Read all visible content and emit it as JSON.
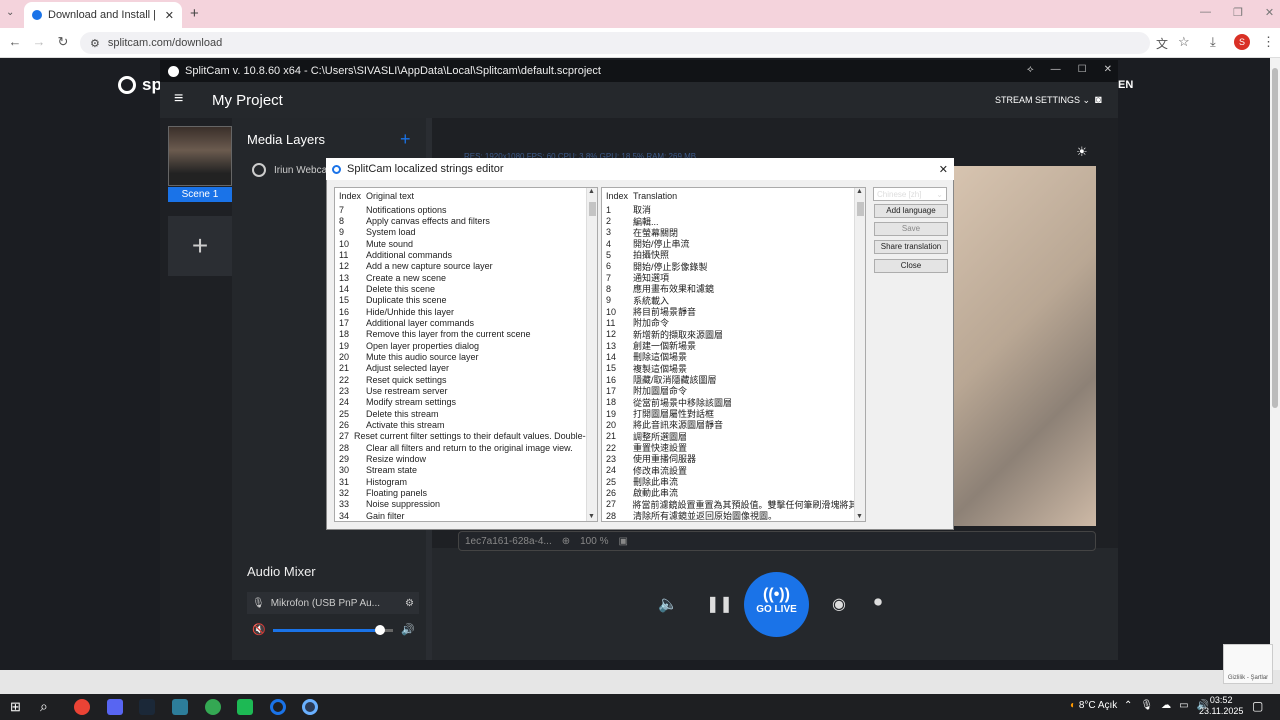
{
  "browser": {
    "tab_title": "Download and Install | SplitCam",
    "url": "splitcam.com/download",
    "profile_initial": "S"
  },
  "site": {
    "logo_text": "spl",
    "lang": "EN"
  },
  "splitcam": {
    "window_title": "SplitCam v. 10.8.60 x64 - C:\\Users\\SIVASLI\\AppData\\Local\\Splitcam\\default.scproject",
    "project_name": "My Project",
    "stream_settings": "STREAM SETTINGS",
    "scene_label": "Scene 1",
    "media_layers_title": "Media Layers",
    "layer_name": "Iriun Webca",
    "stats": "RES: 1920x1080   FPS: 60   CPU: 3.8%   GPU: 18.5%   RAM: 269 MB",
    "info_id": "1ec7a161-628a-4...",
    "zoom": "100 %",
    "go_live": "GO LIVE",
    "audio_mixer_title": "Audio Mixer",
    "mic_name": "Mikrofon (USB PnP Au...",
    "volume": 0.85
  },
  "dialog": {
    "title": "SplitCam localized strings editor",
    "left_headers": [
      "Index",
      "Original text"
    ],
    "right_headers": [
      "Index",
      "Translation"
    ],
    "original": [
      [
        "7",
        "Notifications options"
      ],
      [
        "8",
        "Apply canvas effects and filters"
      ],
      [
        "9",
        "System load"
      ],
      [
        "10",
        "Mute sound"
      ],
      [
        "11",
        "Additional commands"
      ],
      [
        "12",
        "Add a new capture source layer"
      ],
      [
        "13",
        "Create a new scene"
      ],
      [
        "14",
        "Delete this scene"
      ],
      [
        "15",
        "Duplicate this scene"
      ],
      [
        "16",
        "Hide/Unhide this layer"
      ],
      [
        "17",
        "Additional layer commands"
      ],
      [
        "18",
        "Remove this layer from the current scene"
      ],
      [
        "19",
        "Open layer properties dialog"
      ],
      [
        "20",
        "Mute this audio source layer"
      ],
      [
        "21",
        "Adjust selected layer"
      ],
      [
        "22",
        "Reset quick settings"
      ],
      [
        "23",
        "Use restream server"
      ],
      [
        "24",
        "Modify stream settings"
      ],
      [
        "25",
        "Delete this stream"
      ],
      [
        "26",
        "Activate this stream"
      ],
      [
        "27",
        "Reset current filter settings to their default values. Double-click a..."
      ],
      [
        "28",
        "Clear all filters and return to the original image view."
      ],
      [
        "29",
        "Resize window"
      ],
      [
        "30",
        "Stream state"
      ],
      [
        "31",
        "Histogram"
      ],
      [
        "32",
        "Floating panels"
      ],
      [
        "33",
        "Noise suppression"
      ],
      [
        "34",
        "Gain filter"
      ]
    ],
    "translation": [
      [
        "1",
        "取消"
      ],
      [
        "2",
        "編輯..."
      ],
      [
        "3",
        "在螢幕關閉"
      ],
      [
        "4",
        "開始/停止串流"
      ],
      [
        "5",
        "拍攝快照"
      ],
      [
        "6",
        "開始/停止影像錄製"
      ],
      [
        "7",
        "通知選項"
      ],
      [
        "8",
        "應用畫布效果和濾鏡"
      ],
      [
        "9",
        "系統載入"
      ],
      [
        "10",
        "將目前場景靜音"
      ],
      [
        "11",
        "附加命令"
      ],
      [
        "12",
        "新增新的擷取來源圖層"
      ],
      [
        "13",
        "創建一個新場景"
      ],
      [
        "14",
        "刪除這個場景"
      ],
      [
        "15",
        "複製這個場景"
      ],
      [
        "16",
        "隱藏/取消隱藏該圖層"
      ],
      [
        "17",
        "附加圖層命令"
      ],
      [
        "18",
        "從當前場景中移除該圖層"
      ],
      [
        "19",
        "打開圖層屬性對話框"
      ],
      [
        "20",
        "將此音訊來源圖層靜音"
      ],
      [
        "21",
        "調整所選圖層"
      ],
      [
        "22",
        "重置快速設置"
      ],
      [
        "23",
        "使用重播伺服器"
      ],
      [
        "24",
        "修改串流設置"
      ],
      [
        "25",
        "刪除此串流"
      ],
      [
        "26",
        "啟動此串流"
      ],
      [
        "27",
        "將當前濾鏡設置重置為其預設值。雙擊任何筆刷滑塊將其..."
      ],
      [
        "28",
        "清除所有濾鏡並返回原始圖像視圖。"
      ]
    ],
    "language": "Chinese [zh]",
    "buttons": {
      "add_language": "Add language",
      "save": "Save",
      "share": "Share translation",
      "close": "Close"
    }
  },
  "taskbar": {
    "weather": "8°C  Açık",
    "time": "03:52",
    "date": "23.11.2025"
  },
  "recaptcha": "Gizlilik - Şartlar"
}
